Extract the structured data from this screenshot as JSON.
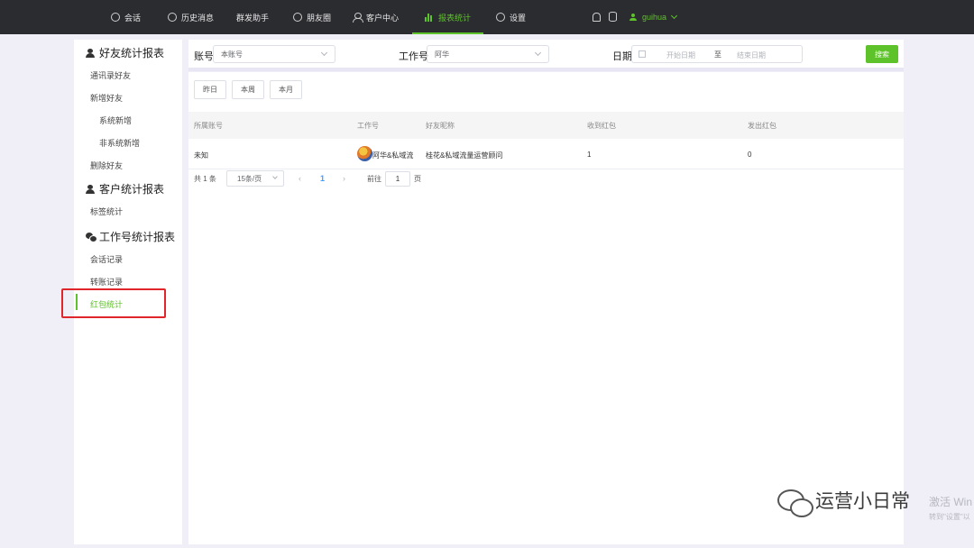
{
  "topnav": {
    "items": [
      {
        "label": "会话",
        "icon": "chat-icon"
      },
      {
        "label": "历史消息",
        "icon": "clock-icon"
      },
      {
        "label": "群发助手",
        "icon": ""
      },
      {
        "label": "朋友圈",
        "icon": "moments-icon"
      },
      {
        "label": "客户中心",
        "icon": "person-icon"
      },
      {
        "label": "报表统计",
        "icon": "bar-chart-icon",
        "active": true
      },
      {
        "label": "设置",
        "icon": "gear-icon"
      }
    ],
    "username": "guihua",
    "accent_color": "#5ec22a"
  },
  "sidebar": {
    "sections": [
      {
        "title": "好友统计报表",
        "items": [
          "通讯录好友",
          "新增好友",
          "系统新增",
          "非系统新增",
          "删除好友"
        ]
      },
      {
        "title": "客户统计报表",
        "items": [
          "标签统计"
        ]
      },
      {
        "title": "工作号统计报表",
        "items": [
          "会话记录",
          "转账记录",
          "红包统计"
        ]
      }
    ],
    "active_item": "红包统计"
  },
  "filters": {
    "account_label": "账号",
    "account_value": "本账号",
    "workno_label": "工作号",
    "workno_value": "阿华",
    "date_label": "日期",
    "date_start_placeholder": "开始日期",
    "date_separator": "至",
    "date_end_placeholder": "结束日期",
    "search_button": "搜索"
  },
  "quick_ranges": [
    "昨日",
    "本周",
    "本月"
  ],
  "table": {
    "columns": [
      "所属账号",
      "工作号",
      "好友昵称",
      "收到红包",
      "发出红包"
    ],
    "rows": [
      {
        "account": "未知",
        "workno": "阿华&私域流",
        "nickname": "桂花&私域流量运营顾问",
        "received": "1",
        "sent": "0"
      }
    ]
  },
  "pagination": {
    "total": "共 1 条",
    "page_size": "15条/页",
    "current_page": "1",
    "prev": "‹",
    "next": "›",
    "goto_label": "前往",
    "goto_value": "1",
    "page_unit": "页"
  },
  "watermark": {
    "text": "运营小日常",
    "activate_line1": "激活 Win",
    "activate_line2": "转到\"设置\"以"
  }
}
